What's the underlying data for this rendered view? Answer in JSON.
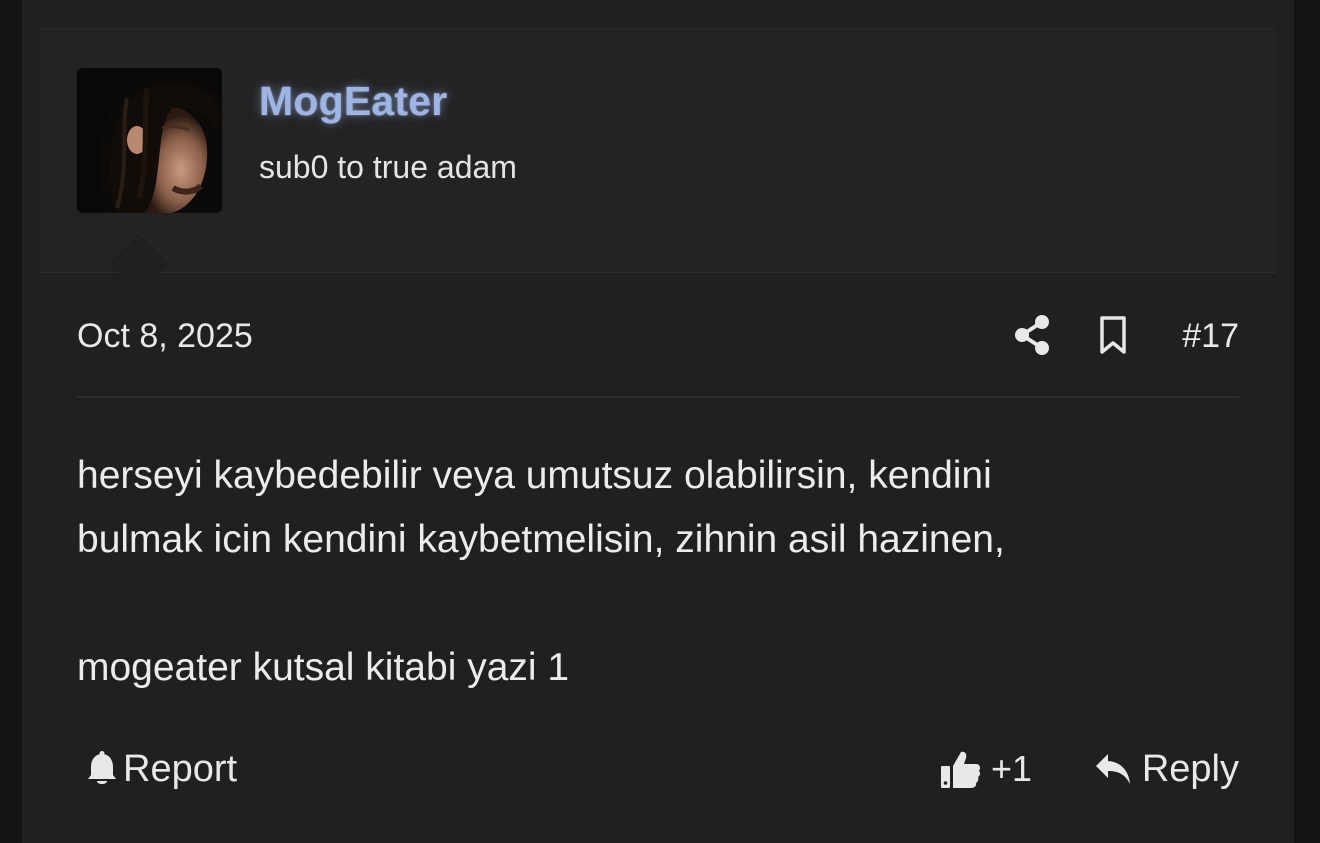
{
  "post": {
    "author": {
      "username": "MogEater",
      "user_title": "sub0 to true adam",
      "avatar_icon": "user-avatar-portrait",
      "username_color": "#9fb4e3"
    },
    "date": "Oct 8, 2025",
    "post_number": "#17",
    "message": {
      "line_1": "herseyi kaybedebilir veya umutsuz olabilirsin, kendini",
      "line_2": "bulmak icin kendini kaybetmelisin, zihnin asil hazinen,",
      "line_3": "mogeater kutsal kitabi yazi 1"
    },
    "icons": {
      "share": "share-icon",
      "bookmark": "bookmark-icon",
      "report": "bell-icon",
      "like": "thumbs-up-icon",
      "reply": "reply-arrow-icon"
    },
    "actions": {
      "report_label": "Report",
      "like_label": "+1",
      "reply_label": "Reply"
    }
  },
  "colors": {
    "page_background": "#141414",
    "post_background": "#202021",
    "header_background": "#232324",
    "text": "#e8e8e8"
  }
}
